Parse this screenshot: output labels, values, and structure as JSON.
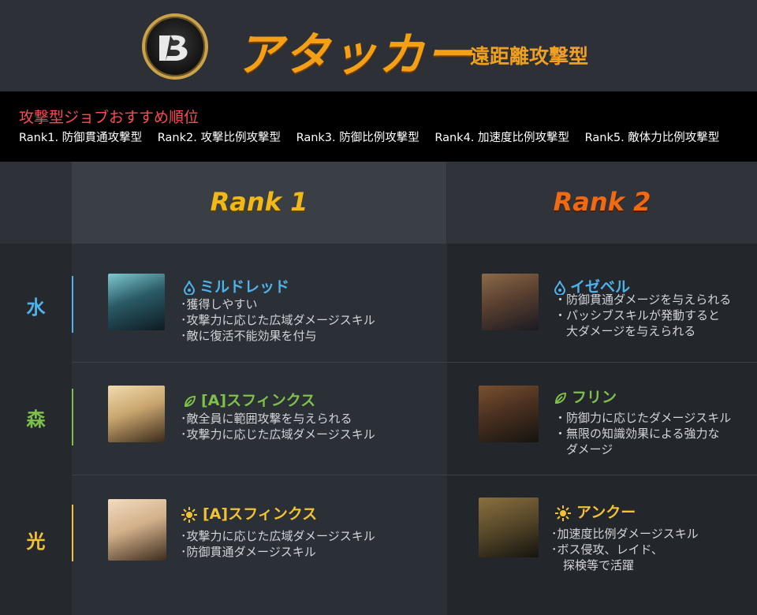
{
  "header": {
    "title": "アタッカー",
    "subtitle": "遠距離攻撃型"
  },
  "recommend": {
    "title": "攻撃型ジョブおすすめ順位",
    "items": [
      "Rank1. 防御貫通攻撃型",
      "Rank2. 攻撃比例攻撃型",
      "Rank3. 防御比例攻撃型",
      "Rank4. 加速度比例攻撃型",
      "Rank5. 敵体力比例攻撃型"
    ]
  },
  "columns": {
    "rank1": "Rank 1",
    "rank2": "Rank 2"
  },
  "elements": {
    "water": "水",
    "forest": "森",
    "light": "光"
  },
  "colors": {
    "water": "#4fb3ea",
    "forest": "#7ec04a",
    "light": "#f2c236",
    "title": "#f3a016",
    "recommend_title": "#ff4a55"
  },
  "cards": {
    "water_r1": {
      "icon": "water-drop-icon",
      "name": "ミルドレッド",
      "lines": [
        "･獲得しやすい",
        "･攻撃力に応じた広域ダメージスキル",
        "･敵に復活不能効果を付与"
      ]
    },
    "water_r2": {
      "icon": "water-drop-icon",
      "name": "イゼベル",
      "lines": [
        "・防御貫通ダメージを与えられる",
        "・パッシブスキルが発動すると",
        "　大ダメージを与えられる"
      ]
    },
    "forest_r1": {
      "icon": "leaf-icon",
      "name": "[A]スフィンクス",
      "lines": [
        "･敵全員に範囲攻撃を与えられる",
        "･攻撃力に応じた広域ダメージスキル"
      ]
    },
    "forest_r2": {
      "icon": "leaf-icon",
      "name": "フリン",
      "lines": [
        "・防御力に応じたダメージスキル",
        "・無限の知識効果による強力な",
        "　ダメージ"
      ]
    },
    "light_r1": {
      "icon": "sun-icon",
      "name": "[A]スフィンクス",
      "lines": [
        "･攻撃力に応じた広域ダメージスキル",
        "･防御貫通ダメージスキル"
      ]
    },
    "light_r2": {
      "icon": "sun-icon",
      "name": "アンクー",
      "lines": [
        "･加速度比例ダメージスキル",
        "･ボス侵攻、レイド、",
        "　探検等で活躍"
      ]
    }
  }
}
